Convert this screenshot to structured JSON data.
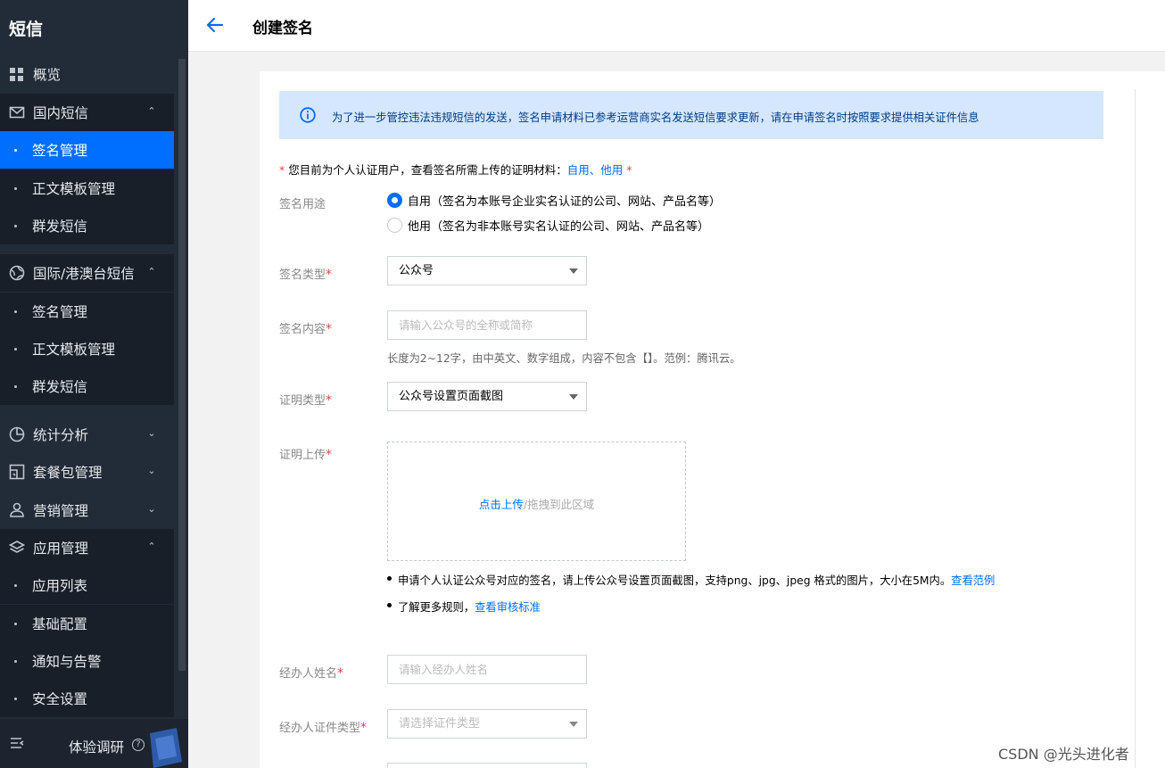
{
  "sidebar": {
    "title": "短信",
    "items": [
      {
        "label": "概览",
        "icon": "grid-icon"
      },
      {
        "label": "国内短信",
        "icon": "mail-icon"
      },
      {
        "label": "签名管理"
      },
      {
        "label": "正文模板管理"
      },
      {
        "label": "群发短信"
      },
      {
        "label": "国际/港澳台短信",
        "icon": "globe-icon"
      },
      {
        "label": "签名管理"
      },
      {
        "label": "正文模板管理"
      },
      {
        "label": "群发短信"
      },
      {
        "label": "统计分析",
        "icon": "pie-chart-icon"
      },
      {
        "label": "套餐包管理",
        "icon": "package-icon"
      },
      {
        "label": "营销管理",
        "icon": "user-group-icon"
      },
      {
        "label": "应用管理",
        "icon": "layers-icon"
      },
      {
        "label": "应用列表"
      },
      {
        "label": "基础配置"
      },
      {
        "label": "通知与告警"
      },
      {
        "label": "安全设置"
      }
    ],
    "footer_label": "体验调研",
    "footer_help": "?"
  },
  "header": {
    "title": "创建签名"
  },
  "notice": {
    "text": "为了进一步管控违法违规短信的发送，签名申请材料已参考运营商实名发送短信要求更新，请在申请签名时按照要求提供相关证件信息"
  },
  "form": {
    "req_intro": "您目前为个人认证用户，查看签名所需上传的证明材料：",
    "req_link_self": "自用",
    "req_sep": "、",
    "req_link_other": "他用",
    "req_mark": "*",
    "usage_label": "签名用途",
    "usage_options": [
      {
        "label": "自用（签名为本账号企业实名认证的公司、网站、产品名等）",
        "selected": true
      },
      {
        "label": "他用（签名为非本账号实名认证的公司、网站、产品名等）",
        "selected": false
      }
    ],
    "type_label": "签名类型",
    "type_value": "公众号",
    "content_label": "签名内容",
    "content_placeholder": "请输入公众号的全称或简称",
    "content_hint": "长度为2~12字，由中英文、数字组成，内容不包含【】。范例：腾讯云。",
    "proof_type_label": "证明类型",
    "proof_type_value": "公众号设置页面截图",
    "upload_label": "证明上传",
    "upload_link": "点击上传",
    "upload_rest": "/拖拽到此区域",
    "bullet1_text": "申请个人认证公众号对应的签名，请上传公众号设置页面截图，支持png、jpg、jpeg 格式的图片，大小在5M内。",
    "bullet1_link": "查看范例",
    "bullet2_text": "了解更多规则，",
    "bullet2_link": "查看审核标准",
    "agent_name_label": "经办人姓名",
    "agent_name_placeholder": "请输入经办人姓名",
    "agent_id_type_label": "经办人证件类型",
    "agent_id_type_placeholder": "请选择证件类型"
  },
  "watermark": "CSDN @光头进化者",
  "colors": {
    "sidebar_bg": "#222b38",
    "accent": "#006eff",
    "notice_bg": "#d5e7ff",
    "required": "#e54545"
  }
}
